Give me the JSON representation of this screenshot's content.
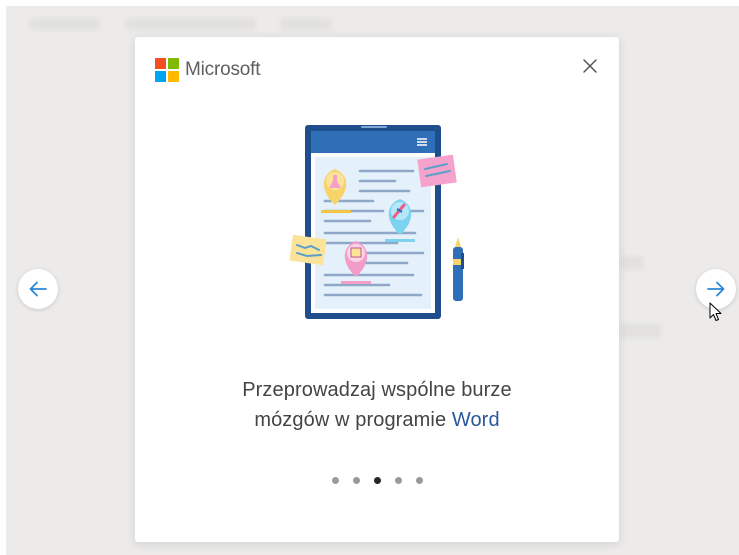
{
  "colors": {
    "backdrop": "#ecebea",
    "accent": "#2b579a",
    "arrow": "#2b88d8",
    "ms_red": "#f25022",
    "ms_green": "#7fba00",
    "ms_blue": "#00a4ef",
    "ms_yellow": "#ffb900"
  },
  "modal": {
    "brand": "Microsoft",
    "close_icon": "close-icon",
    "illustration": "tablet-brainstorm-illustration",
    "headline": {
      "line1": "Przeprowadzaj wspólne burze",
      "line2_prefix": "mózgów w programie ",
      "line2_accent": "Word"
    },
    "pagination": {
      "total": 5,
      "active_index": 2
    }
  },
  "navigation": {
    "prev_icon": "arrow-left-icon",
    "next_icon": "arrow-right-icon"
  }
}
